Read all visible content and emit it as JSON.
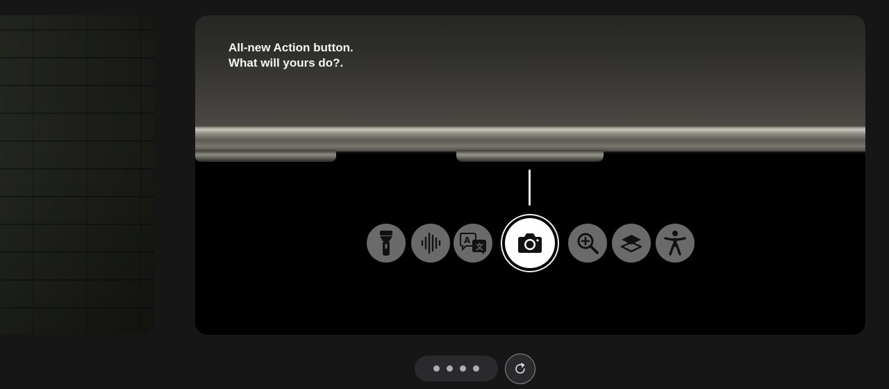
{
  "slide": {
    "headline_line1": "All-new Action button.",
    "headline_line2": "What will yours do?."
  },
  "actions": [
    {
      "icon": "flashlight-icon",
      "label": "Flashlight"
    },
    {
      "icon": "voice-memo-icon",
      "label": "Voice Memo"
    },
    {
      "icon": "translate-icon",
      "label": "Translate"
    },
    {
      "icon": "camera-icon",
      "label": "Camera",
      "active": true
    },
    {
      "icon": "magnifier-icon",
      "label": "Magnifier"
    },
    {
      "icon": "focus-icon",
      "label": "Focus"
    },
    {
      "icon": "accessibility-icon",
      "label": "Accessibility"
    }
  ],
  "pagination": {
    "count": 4,
    "active_index": 0
  },
  "controls": {
    "replay_icon": "replay-icon"
  },
  "colors": {
    "page_background": "#161617",
    "icon_background": "#6a6a6a",
    "active_icon_background": "#ffffff",
    "text": "#f5f5f7"
  }
}
